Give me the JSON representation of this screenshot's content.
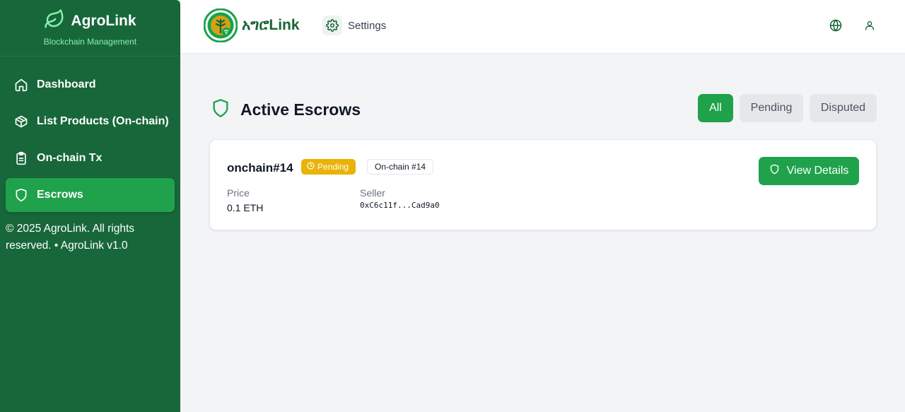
{
  "sidebar": {
    "brand_name": "AgroLink",
    "brand_subtitle": "Blockchain Management",
    "items": [
      {
        "label": "Dashboard",
        "icon": "home-icon"
      },
      {
        "label": "List Products (On-chain)",
        "icon": "box-icon"
      },
      {
        "label": "On-chain Tx",
        "icon": "clipboard-icon"
      },
      {
        "label": "Escrows",
        "icon": "shield-icon",
        "active": true
      }
    ],
    "footer": "© 2025 AgroLink. All rights reserved. • AgroLink v1.0"
  },
  "header": {
    "logo_text": "አግሮLink",
    "settings_label": "Settings",
    "icons": [
      "globe-icon",
      "user-icon"
    ]
  },
  "main": {
    "title": "Active Escrows",
    "title_icon": "shield-icon",
    "filters": [
      {
        "label": "All",
        "active": true
      },
      {
        "label": "Pending",
        "active": false
      },
      {
        "label": "Disputed",
        "active": false
      }
    ],
    "escrows": [
      {
        "id": "onchain#14",
        "status": "Pending",
        "chain_badge": "On-chain #14",
        "price_label": "Price",
        "price": "0.1 ETH",
        "seller_label": "Seller",
        "seller": "0xC6c11f...Cad9a0",
        "action_label": "View Details"
      }
    ]
  },
  "colors": {
    "sidebar_bg": "#17673a",
    "accent": "#1fa24b",
    "pending": "#eab308",
    "page_bg": "#f3f4f6"
  }
}
